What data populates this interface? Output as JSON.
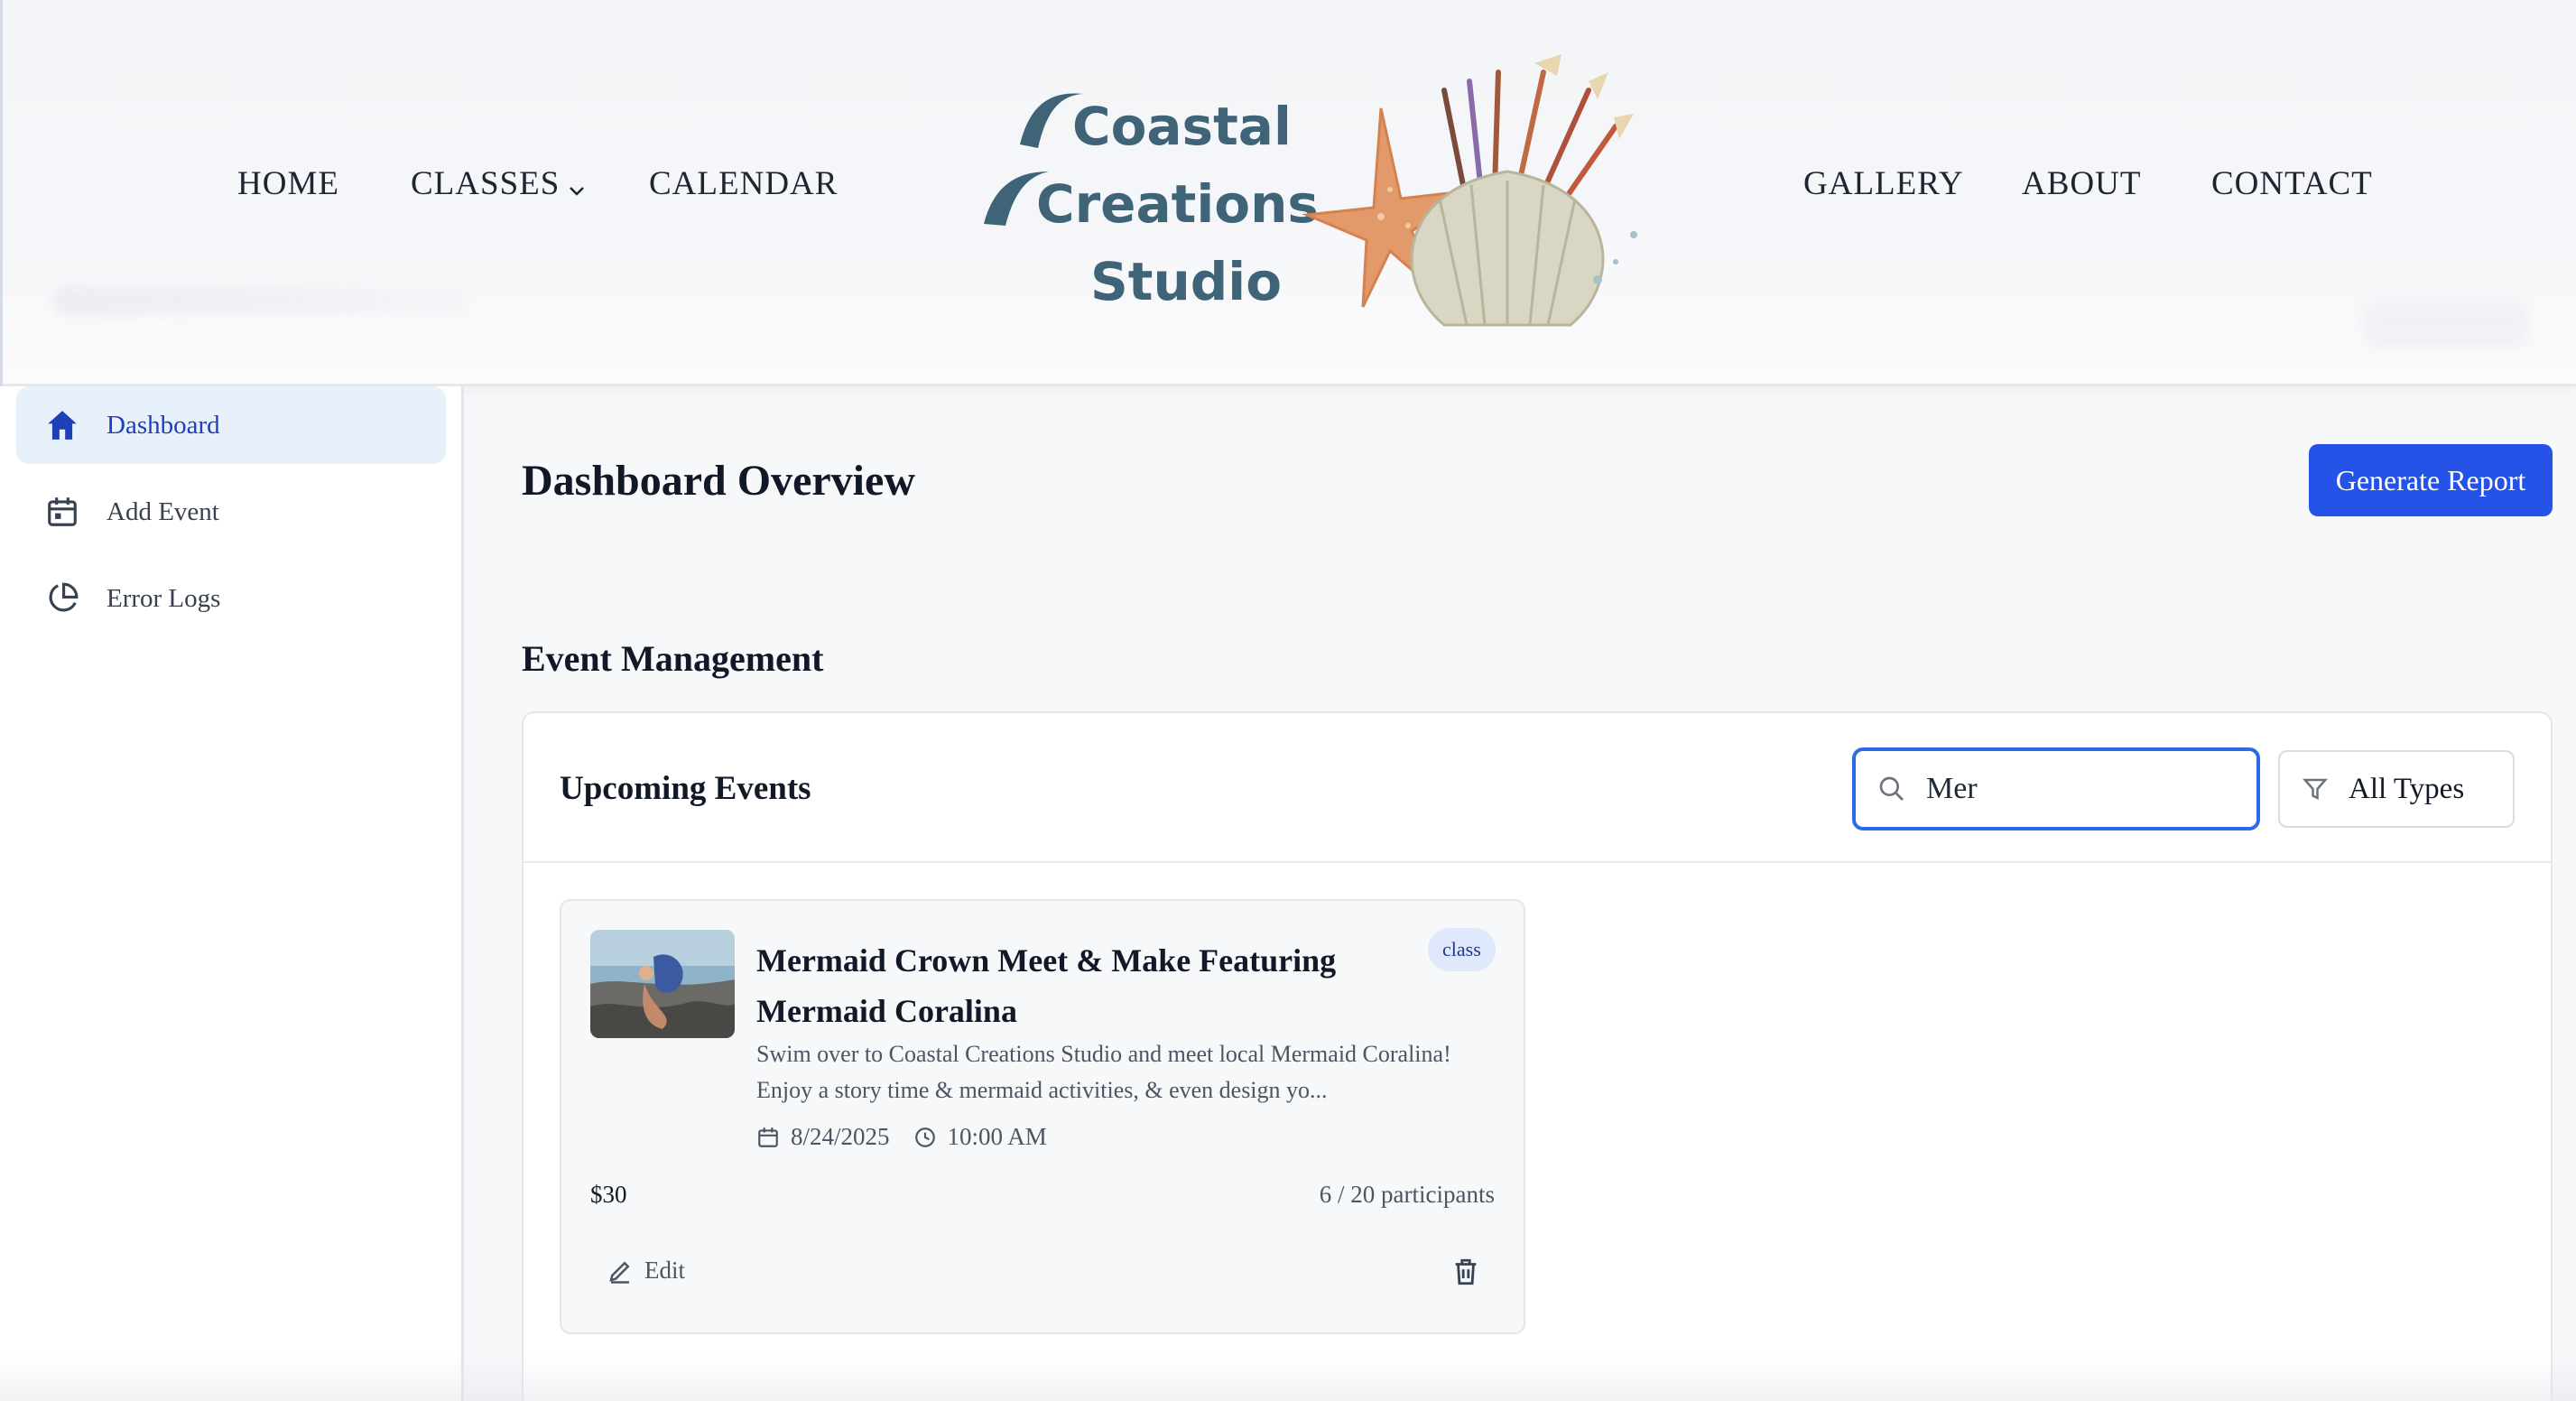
{
  "nav": {
    "left": [
      "HOME",
      "CLASSES",
      "CALENDAR"
    ],
    "right": [
      "GALLERY",
      "ABOUT",
      "CONTACT"
    ]
  },
  "logo": {
    "line1": "Coastal",
    "line2": "Creations",
    "line3": "Studio"
  },
  "sidebar": {
    "items": [
      {
        "label": "Dashboard",
        "icon": "home-icon",
        "active": true
      },
      {
        "label": "Add Event",
        "icon": "calendar-icon",
        "active": false
      },
      {
        "label": "Error Logs",
        "icon": "pie-chart-icon",
        "active": false
      }
    ]
  },
  "main": {
    "title": "Dashboard Overview",
    "report_button": "Generate Report",
    "section_title": "Event Management",
    "panel_title": "Upcoming Events",
    "search": {
      "value": "Mer",
      "icon": "search-icon"
    },
    "filter": {
      "label": "All Types",
      "icon": "filter-icon"
    }
  },
  "event": {
    "title": "Mermaid Crown Meet & Make Featuring Mermaid Coralina",
    "badge": "class",
    "description": "Swim over to Coastal Creations Studio and meet local Mermaid Coralina! Enjoy a story time & mermaid activities, & even design yo...",
    "date": "8/24/2025",
    "time": "10:00 AM",
    "price": "$30",
    "participants": "6 / 20 participants",
    "edit_label": "Edit"
  },
  "colors": {
    "accent": "#2553e8",
    "active_bg": "#e8f0fc",
    "logo_text": "#3f6478"
  }
}
